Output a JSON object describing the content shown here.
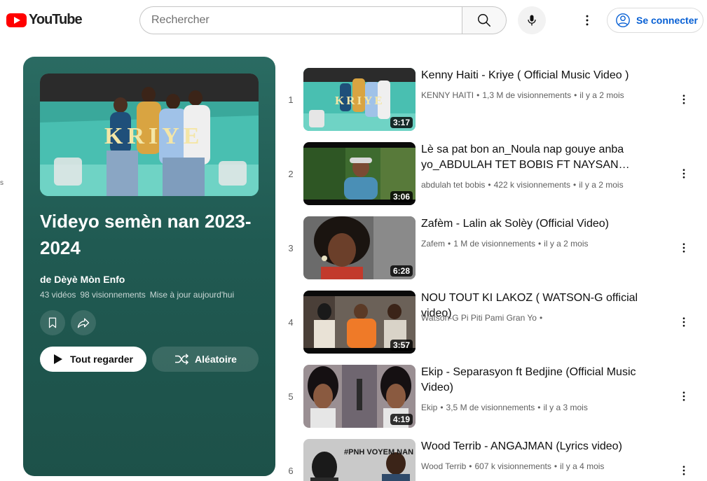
{
  "header": {
    "logo_text": "YouTube",
    "search_placeholder": "Rechercher",
    "signin_label": "Se connecter"
  },
  "edge_fragment": "s",
  "playlist": {
    "title": "Videyo semèn nan 2023-2024",
    "owner": "de Dèyè Mòn Enfo",
    "video_count": "43 vidéos",
    "views": "98 visionnements",
    "updated": "Mise à jour aujourd'hui",
    "thumb_text": "KRIYE",
    "play_all_label": "Tout regarder",
    "shuffle_label": "Aléatoire"
  },
  "videos": [
    {
      "index": "1",
      "title": "Kenny Haiti - Kriye ( Official Music Video )",
      "channel": "KENNY HAITI",
      "views": "1,3 M de visionnements",
      "age": "il y a 2 mois",
      "duration": "3:17",
      "thumb_text": "KRIYE"
    },
    {
      "index": "2",
      "title": "Lè sa pat bon an_Noula nap gouye anba yo_ABDULAH TET BOBIS FT NAYSAN @SMAT-…",
      "channel": "abdulah tet bobis",
      "views": "422 k visionnements",
      "age": "il y a 2 mois",
      "duration": "3:06",
      "thumb_text": ""
    },
    {
      "index": "3",
      "title": "Zafèm - Lalin ak Solèy (Official Video)",
      "channel": "Zafem",
      "views": "1 M de visionnements",
      "age": "il y a 2 mois",
      "duration": "6:28",
      "thumb_text": ""
    },
    {
      "index": "4",
      "title": "NOU TOUT KI LAKOZ ( WATSON-G official video)",
      "channel": "Watson-G Pi Piti Pami Gran Yo",
      "views": "",
      "age": "",
      "duration": "3:57",
      "thumb_text": ""
    },
    {
      "index": "5",
      "title": "Ekip - Separasyon ft Bedjine (Official Music Video)",
      "channel": "Ekip",
      "views": "3,5 M de visionnements",
      "age": "il y a 3 mois",
      "duration": "4:19",
      "thumb_text": ""
    },
    {
      "index": "6",
      "title": "Wood Terrib - ANGAJMAN (Lyrics video)",
      "channel": "Wood Terrib",
      "views": "607 k visionnements",
      "age": "il y a 4 mois",
      "duration": "",
      "thumb_text": "#PNH VOYEM NAN"
    }
  ],
  "colors": {
    "panel_bg": "#205a52",
    "brand_red": "#ff0000",
    "link_blue": "#065fd4"
  }
}
